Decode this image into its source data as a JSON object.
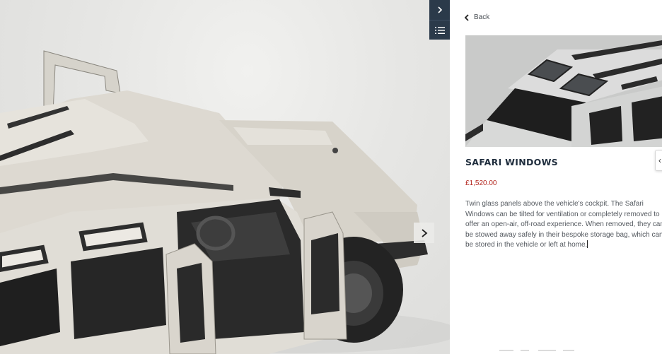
{
  "viewer": {
    "collapse_icon": "chevron-right-icon",
    "list_icon": "list-icon",
    "next_icon": "chevron-right-icon"
  },
  "panel": {
    "back_label": "Back",
    "back_icon": "chevron-left-icon",
    "title": "SAFARI WINDOWS",
    "price": "£1,520.00",
    "description": "Twin glass panels above the vehicle's cockpit. The Safari Windows can be tilted for ventilation or completely removed to offer an open-air, off-road experience. When removed, they can be stowed away safely in their bespoke storage bag, which can be stored in the vehicle or left at home."
  },
  "colors": {
    "toolbar_bg": "#2b3a4a",
    "title": "#1f2d3d",
    "price": "#b3261e",
    "body_text": "#555a60",
    "car_body": "#dcd9d1"
  }
}
